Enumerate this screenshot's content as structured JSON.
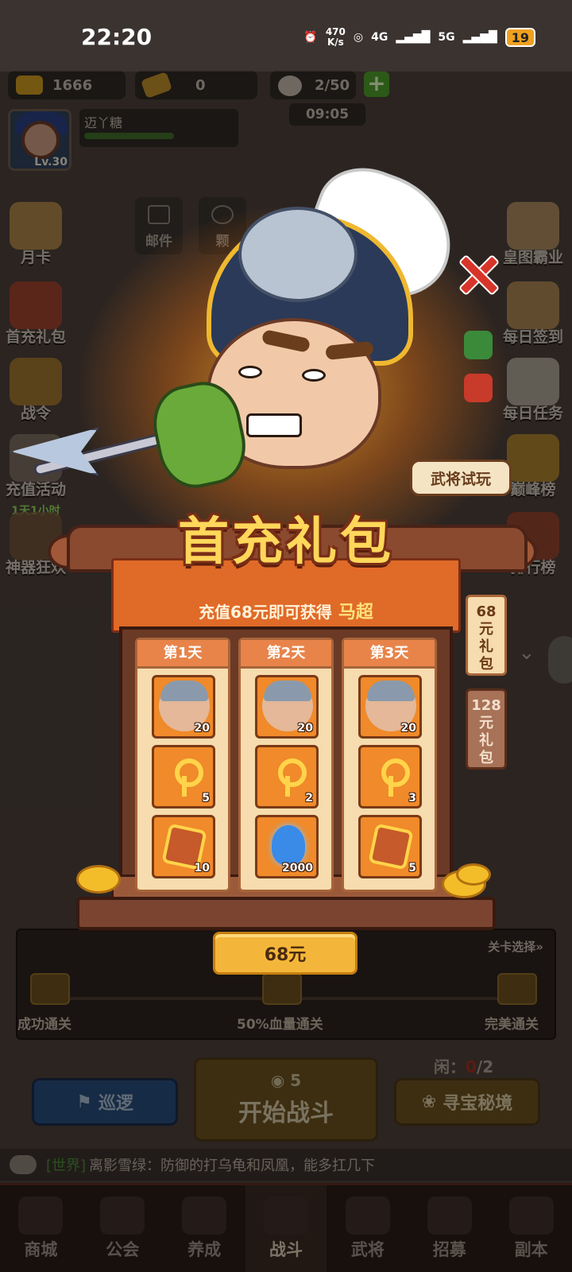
{
  "status_bar": {
    "time": "22:20",
    "net_speed_value": "470",
    "net_speed_unit": "K/s",
    "sim1": "4G",
    "sim2": "5G",
    "battery": "19"
  },
  "resources": {
    "gold": "1666",
    "tickets": "0",
    "stamina": "2/50",
    "stamina_timer": "09:05"
  },
  "player": {
    "name": "迈丫糖",
    "level": "Lv.30",
    "exp_fraction": 0.75
  },
  "left_menu": [
    {
      "label": "月卡"
    },
    {
      "label": "首充礼包"
    },
    {
      "label": "战令"
    },
    {
      "label": "充值活动"
    },
    {
      "label": "神器狂欢",
      "sub": "1天1小时"
    }
  ],
  "right_menu": [
    {
      "label": "皇图霸业"
    },
    {
      "label": "每日签到"
    },
    {
      "label": "每日任务"
    },
    {
      "label": "巅峰榜"
    },
    {
      "label": "排行榜"
    }
  ],
  "top_center": {
    "mail": "邮件",
    "other": "颗"
  },
  "popup": {
    "title": "首充礼包",
    "subtitle": "充值68元即可获得",
    "hero_name": "马超",
    "trial_button": "武将试玩",
    "days": [
      {
        "label": "第1天",
        "rewards": [
          {
            "type": "hero-shard",
            "count": "20"
          },
          {
            "type": "key",
            "count": "5"
          },
          {
            "type": "token",
            "count": "10"
          }
        ]
      },
      {
        "label": "第2天",
        "rewards": [
          {
            "type": "hero-shard",
            "count": "20"
          },
          {
            "type": "key",
            "count": "2"
          },
          {
            "type": "soul",
            "count": "2000"
          }
        ]
      },
      {
        "label": "第3天",
        "rewards": [
          {
            "type": "hero-shard",
            "count": "20"
          },
          {
            "type": "key",
            "count": "3"
          },
          {
            "type": "token",
            "count": "5"
          }
        ]
      }
    ],
    "price_button": "68元",
    "pack_tabs": [
      {
        "label": "68元礼包",
        "lines": [
          "68",
          "元",
          "礼",
          "包"
        ],
        "active": true
      },
      {
        "label": "128元礼包",
        "lines": [
          "128",
          "元",
          "礼",
          "包"
        ],
        "active": false
      }
    ]
  },
  "stage": {
    "select": "关卡选择»",
    "goals": [
      "成功通关",
      "50%血量通关",
      "完美通关"
    ]
  },
  "actions": {
    "patrol": "巡逻",
    "fight": "开始战斗",
    "fight_cost": "5",
    "treasure": "寻宝秘境",
    "idle_label": "闲：",
    "idle_value": "0",
    "idle_max": "/2"
  },
  "chat": {
    "channel": "[世界]",
    "message": "离影雪绿：防御的打乌龟和凤凰，能多扛几下"
  },
  "tabs": [
    {
      "label": "商城",
      "active": false
    },
    {
      "label": "公会",
      "active": false
    },
    {
      "label": "养成",
      "active": false
    },
    {
      "label": "战斗",
      "active": true
    },
    {
      "label": "武将",
      "active": false
    },
    {
      "label": "招募",
      "active": false
    },
    {
      "label": "副本",
      "active": false
    }
  ],
  "colors": {
    "accent_orange": "#e06a28",
    "title_gold": "#ffd75a",
    "close_red": "#d8342a",
    "price_gold": "#f4b63a"
  }
}
